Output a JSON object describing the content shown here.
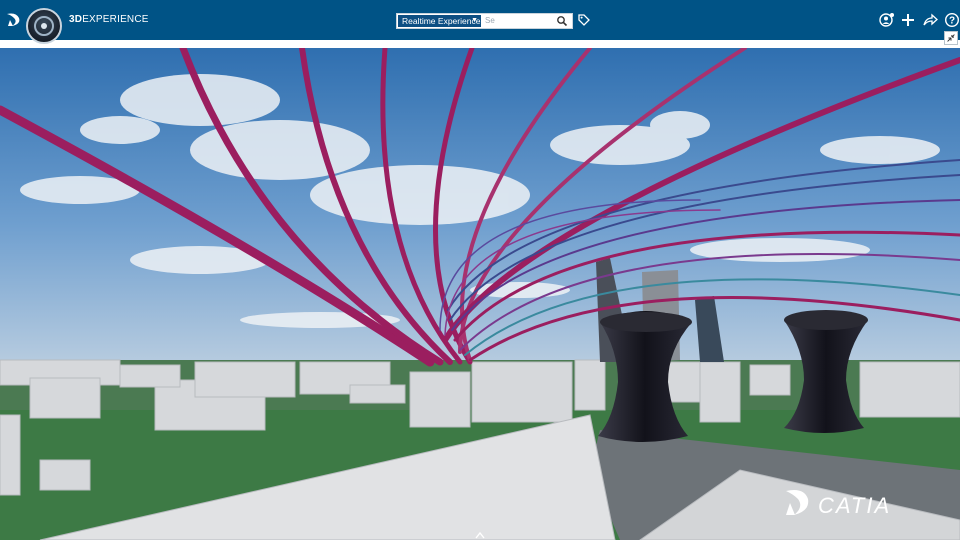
{
  "header": {
    "brand_bold": "3D",
    "brand_rest": "EXPERIENCE",
    "search_context": "Realtime Experience",
    "search_placeholder": "Se",
    "icons": [
      "3ds-logo-icon",
      "compass-icon",
      "search-icon",
      "tag-icon",
      "user-profile-icon",
      "add-icon",
      "share-icon",
      "help-icon",
      "collapse-icon"
    ]
  },
  "viewport": {
    "watermark": "CATIA",
    "scene": "3D city model with magenta and blue tube structures, dark hourglass towers, sky with clouds"
  },
  "colors": {
    "topbar": "#005386",
    "tube_magenta": "#9b1e5f",
    "tube_blue": "#3a4a8e",
    "grass": "#3d7a45",
    "tower": "#1a1a24"
  }
}
